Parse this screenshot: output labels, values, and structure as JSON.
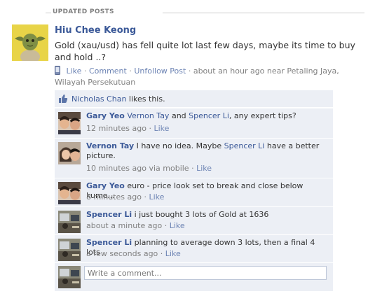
{
  "section": {
    "title": "UPDATED POSTS"
  },
  "post": {
    "author": "Hiu Chee Keong",
    "text": "Gold (xau/usd) has fell quite lot last few days, maybe its time to buy and hold ..?",
    "actions": {
      "like": "Like",
      "comment": "Comment",
      "unfollow": "Unfollow Post"
    },
    "meta_time": "about an hour ago near Petaling Jaya, Wilayah Persekutuan",
    "separator": "·"
  },
  "likes": {
    "name": "Nicholas Chan",
    "suffix": " likes this."
  },
  "comments": [
    {
      "author": "Gary Yeo",
      "text_parts": {
        "mention1": "Vernon Tay",
        "and": " and ",
        "mention2": "Spencer Li",
        "rest": ", any expert tips?"
      },
      "time": "12 minutes ago",
      "like": "Like"
    },
    {
      "author": "Vernon Tay",
      "text_parts": {
        "pre": " I have no idea. Maybe ",
        "mention": "Spencer Li",
        "post": " have a better picture."
      },
      "time": "10 minutes ago via mobile",
      "like": "Like"
    },
    {
      "author": "Gary Yeo",
      "text": " euro - price look set to break and close below kumo...",
      "time": "8 minutes ago",
      "like": "Like"
    },
    {
      "author": "Spencer Li",
      "text": " i just bought 3 lots of Gold at 1636",
      "time": "about a minute ago",
      "like": "Like"
    },
    {
      "author": "Spencer Li",
      "text": " planning to average down 3 lots, then a final 4 lots",
      "time": "a few seconds ago",
      "like": "Like"
    }
  ],
  "write_comment": {
    "placeholder": "Write a comment..."
  },
  "colors": {
    "link": "#3b5998",
    "feedback_bg": "#eceff5",
    "meta": "#808080"
  }
}
